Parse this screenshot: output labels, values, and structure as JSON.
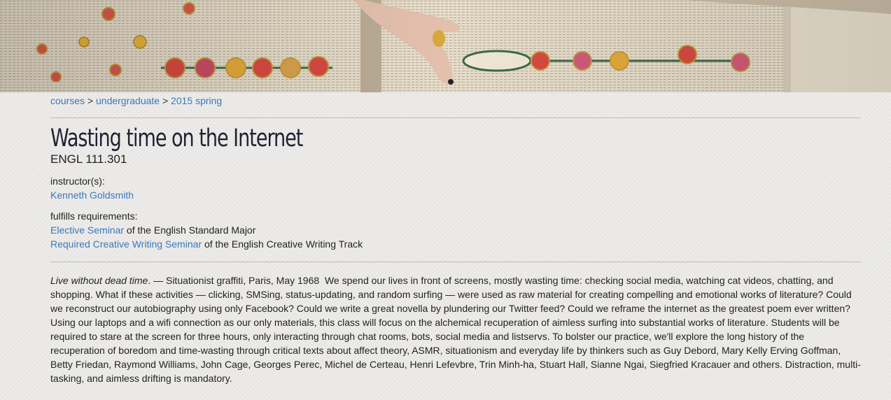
{
  "breadcrumb": {
    "items": [
      "courses",
      "undergraduate",
      "2015 spring"
    ],
    "separator": ">"
  },
  "course": {
    "title": "Wasting time on the Internet",
    "code": "ENGL 111.301"
  },
  "instructors": {
    "label": "instructor(s):",
    "names": [
      "Kenneth Goldsmith"
    ]
  },
  "requirements": {
    "label": "fulfills requirements:",
    "items": [
      {
        "link": "Elective Seminar",
        "text": " of the English Standard Major"
      },
      {
        "link": "Required Creative Writing Seminar",
        "text": " of the English Creative Writing Track"
      }
    ]
  },
  "description": {
    "epigraph": "Live without dead time",
    "attribution": ". — Situationist graffiti, Paris, May 1968  ",
    "body": "We spend our lives in front of screens, mostly wasting time: checking social media, watching cat videos, chatting, and shopping. What if these activities — clicking, SMSing, status-updating, and random surfing — were used as raw material for creating compelling and emotional works of literature? Could we reconstruct our autobiography using only Facebook? Could we write a great novella by plundering our Twitter feed? Could we reframe the internet as the greatest poem ever written? Using our laptops and a wifi connection as our only materials, this class will focus on the alchemical recuperation of aimless surfing into substantial works of literature. Students will be required to stare at the screen for three hours, only interacting through chat rooms, bots, social media and listservs. To bolster our practice, we'll explore the long history of the recuperation of boredom and time-wasting through critical texts about affect theory, ASMR, situationism and everyday life by thinkers such as Guy Debord, Mary Kelly Erving Goffman, Betty Friedan, Raymond Williams, John Cage, Georges Perec, Michel de Certeau, Henri Lefevbre, Trin Minh-ha, Stuart Hall, Sianne Ngai, Siegfried Kracauer and others. Distraction, multi-tasking, and aimless drifting is mandatory."
  },
  "colors": {
    "link": "#3b78b8",
    "background": "#e9e8e6",
    "title": "#1d2330"
  }
}
